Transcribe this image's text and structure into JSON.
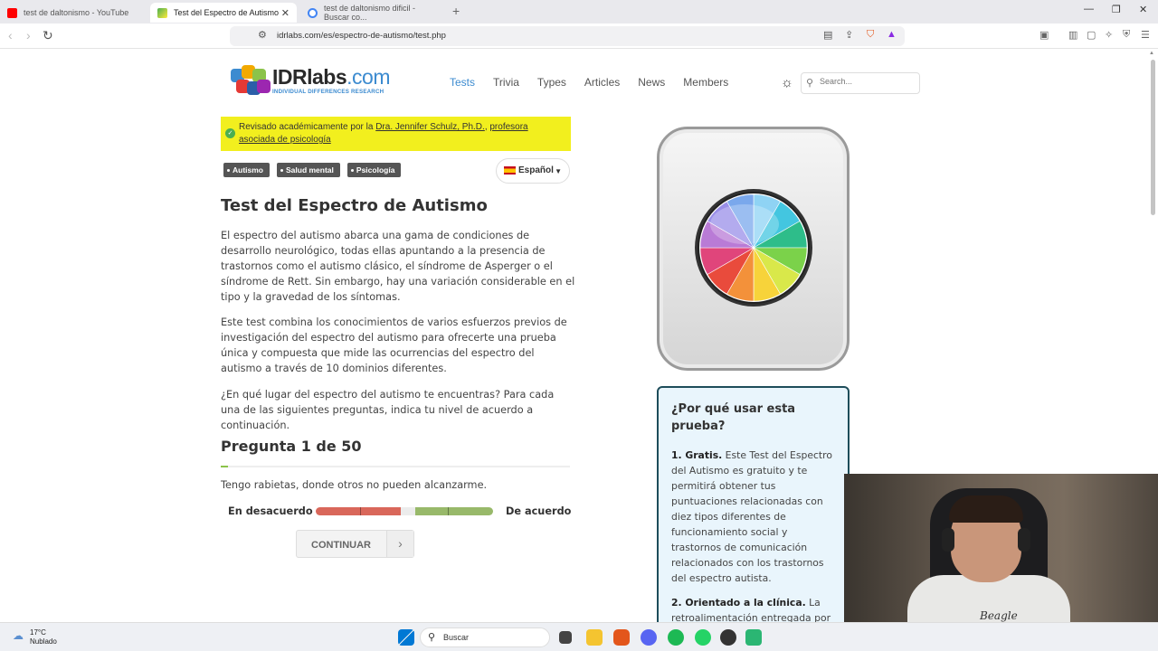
{
  "browser": {
    "tabs": [
      {
        "title": "test de daltonismo - YouTube",
        "color": "#ff0000"
      },
      {
        "title": "Test del Espectro de Autismo",
        "color": "#4caf50"
      },
      {
        "title": "test de daltonismo dificil - Buscar co...",
        "color": "#4285f4"
      }
    ],
    "url": "idrlabs.com/es/espectro-de-autismo/test.php"
  },
  "site": {
    "brand": "IDRlabs",
    "brand_suffix": ".com",
    "brand_sub": "INDIVIDUAL DIFFERENCES RESEARCH",
    "nav": [
      "Tests",
      "Trivia",
      "Types",
      "Articles",
      "News",
      "Members"
    ],
    "search_placeholder": "Search...",
    "accent_color": "#3c8bd0"
  },
  "review": {
    "prefix": "Revisado académicamente por la ",
    "author": "Dra. Jennifer Schulz, Ph.D.",
    "sep": ", ",
    "role": "profesora asociada de psicología"
  },
  "tags": [
    "Autismo",
    "Salud mental",
    "Psicología"
  ],
  "language": "Español",
  "article": {
    "title": "Test del Espectro de Autismo",
    "p1": "El espectro del autismo abarca una gama de condiciones de desarrollo neurológico, todas ellas apuntando a la presencia de trastornos como el autismo clásico, el síndrome de Asperger o el síndrome de Rett. Sin embargo, hay una variación considerable en el tipo y la gravedad de los síntomas.",
    "p2": "Este test combina los conocimientos de varios esfuerzos previos de investigación del espectro del autismo para ofrecerte una prueba única y compuesta que mide las ocurrencias del espectro del autismo a través de 10 dominios diferentes.",
    "p3": "¿En qué lugar del espectro del autismo te encuentras? Para cada una de las siguientes preguntas, indica tu nivel de acuerdo a continuación."
  },
  "question": {
    "title": "Pregunta 1 de 50",
    "progress": 0.02,
    "text": "Tengo rabietas, donde otros no pueden alcanzarme.",
    "left_label": "En desacuerdo",
    "right_label": "De acuerdo",
    "continue_label": "CONTINUAR"
  },
  "sidebar": {
    "why_title": "¿Por qué usar esta prueba?",
    "point1_title": "1. Gratis.",
    "point1_text": " Este Test del Espectro del Autismo es gratuito y te permitirá obtener tus puntuaciones relacionadas con diez tipos diferentes de funcionamiento social y trastornos de comunicación relacionados con los trastornos del espectro autista.",
    "point2_title": "2. Orientado a la clínica.",
    "point2_text": " La retroalimentación entregada por"
  },
  "webcam": {
    "shirt_text": "Beagle"
  },
  "taskbar": {
    "temp": "17°C",
    "condition": "Nublado",
    "search": "Buscar"
  }
}
